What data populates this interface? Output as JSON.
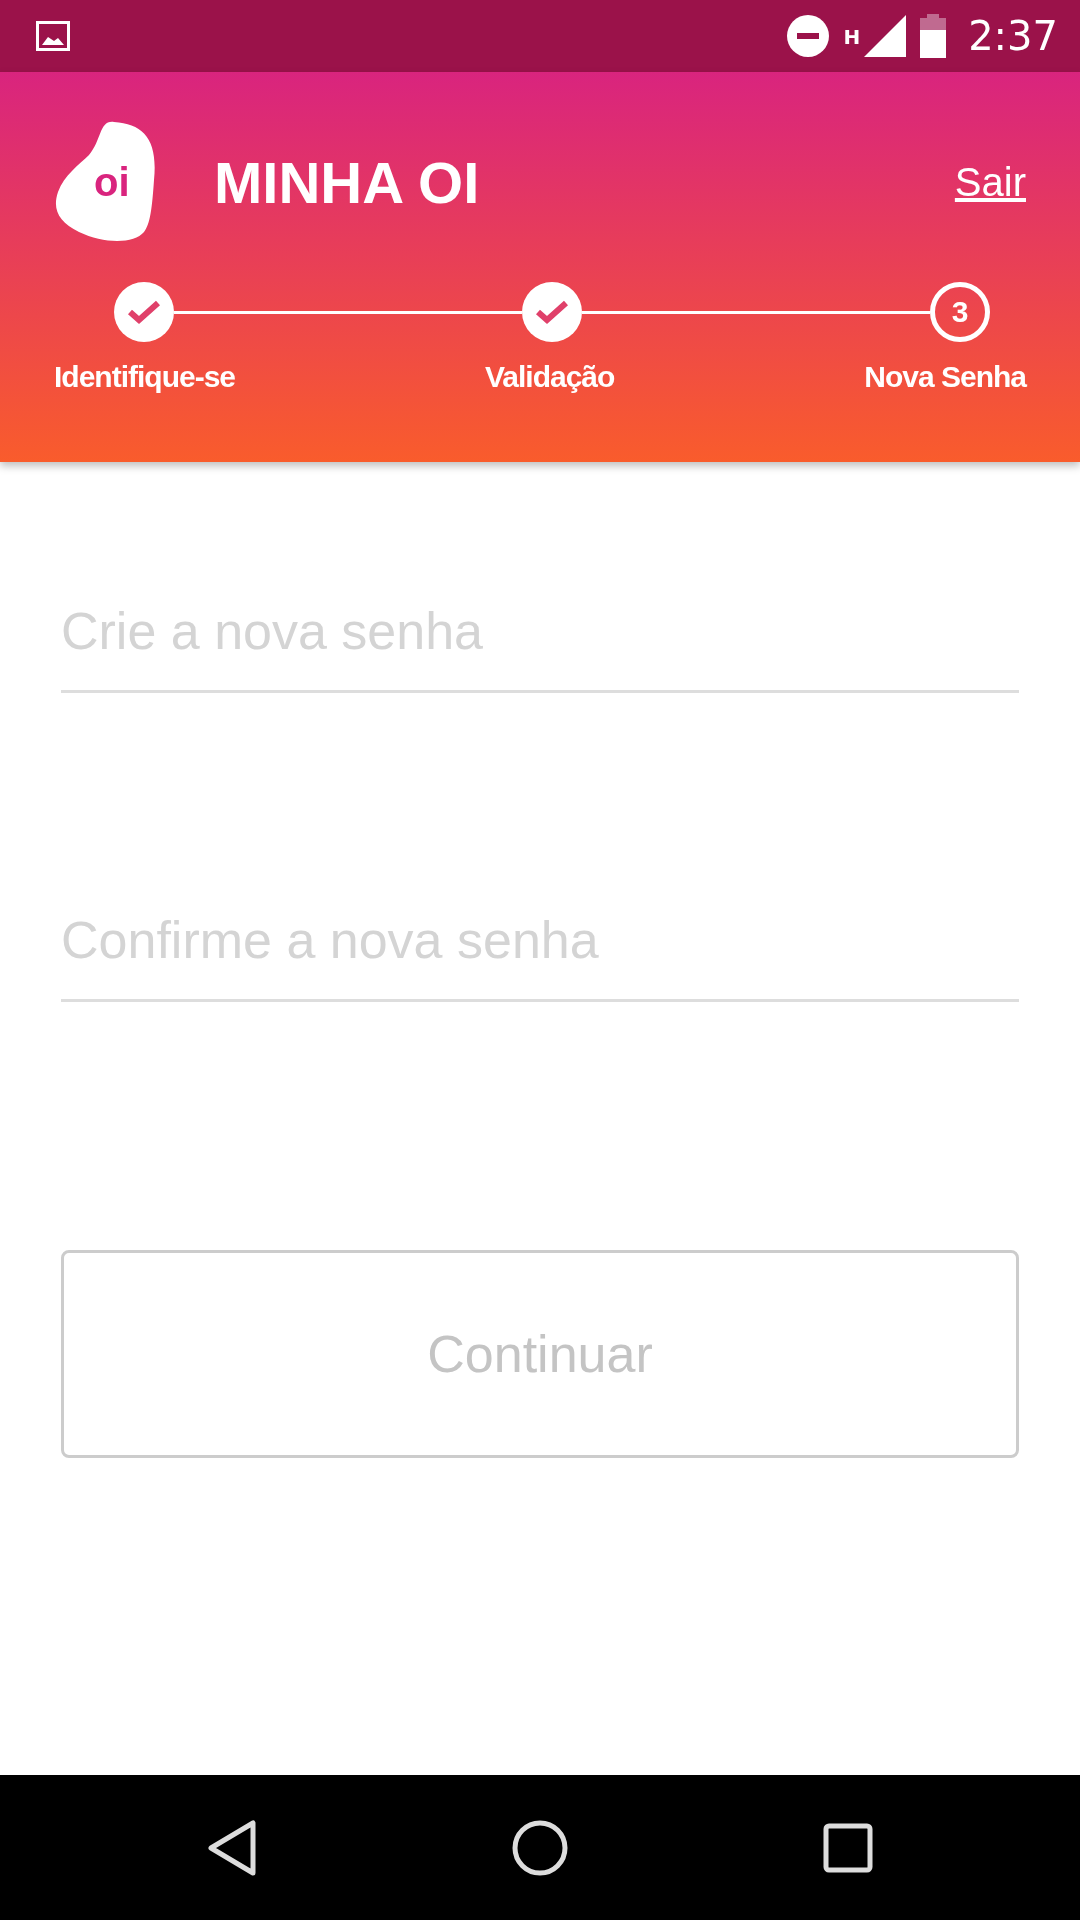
{
  "status_bar": {
    "time": "2:37",
    "network": "H"
  },
  "header": {
    "title": "MINHA OI",
    "logo_text": "oi",
    "logout": "Sair"
  },
  "steps": [
    {
      "label": "Identifique-se",
      "done": true
    },
    {
      "label": "Validação",
      "done": true
    },
    {
      "label": "Nova Senha",
      "done": false,
      "number": "3"
    }
  ],
  "fields": [
    {
      "placeholder": "Crie a nova senha"
    },
    {
      "placeholder": "Confirme a nova senha"
    }
  ],
  "button": {
    "label": "Continuar",
    "disabled": true
  }
}
